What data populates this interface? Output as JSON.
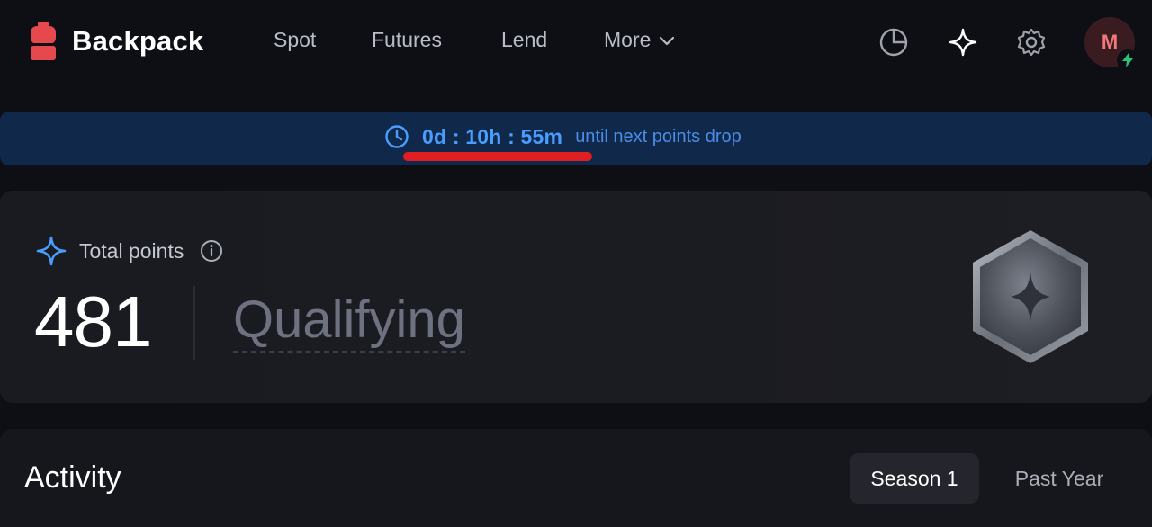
{
  "nav": {
    "brand": "Backpack",
    "links": [
      "Spot",
      "Futures",
      "Lend"
    ],
    "more_label": "More",
    "icons": [
      "pie-chart-icon",
      "sparkle-icon",
      "gear-icon"
    ],
    "avatar_letter": "M",
    "avatar_badge_icon": "lightning-icon"
  },
  "banner": {
    "countdown": "0d : 10h : 55m",
    "suffix": "until next points drop",
    "highlight_color": "#e01e24",
    "text_color": "#4a9cff"
  },
  "points": {
    "label": "Total points",
    "value": "481",
    "status": "Qualifying",
    "badge_icon": "hexagon-star-badge"
  },
  "activity": {
    "title": "Activity",
    "tabs": [
      {
        "label": "Season 1",
        "active": true
      },
      {
        "label": "Past Year",
        "active": false
      }
    ]
  },
  "colors": {
    "background": "#0e0f14",
    "brand_red": "#e5484d",
    "accent_blue": "#4a9cff",
    "banner_bg": "#10284a"
  }
}
